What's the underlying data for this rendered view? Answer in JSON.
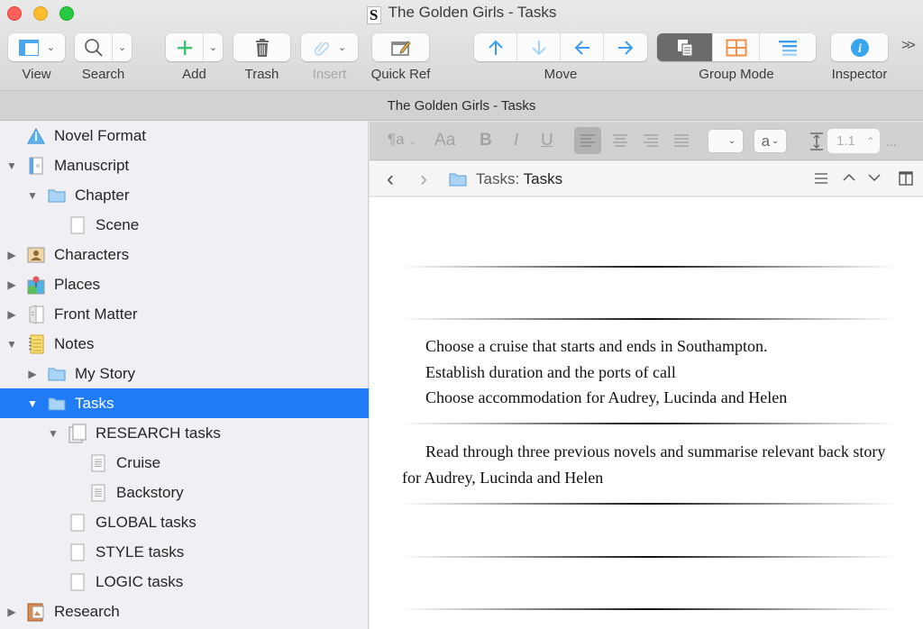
{
  "window": {
    "title": "The Golden Girls - Tasks",
    "app_icon": "scrivener-document-icon"
  },
  "toolbar": {
    "view_label": "View",
    "search_label": "Search",
    "add_label": "Add",
    "trash_label": "Trash",
    "insert_label": "Insert",
    "quickref_label": "Quick Ref",
    "move_label": "Move",
    "groupmode_label": "Group Mode",
    "inspector_label": "Inspector",
    "overflow": "»",
    "accent_blue": "#3b9cf0",
    "add_green": "#3cc373",
    "corkboard_orange": "#f0904a",
    "group_mode_selected": "scrivenings"
  },
  "header": {
    "title": "The Golden Girls - Tasks"
  },
  "binder": {
    "selection_color": "#1f7cf6",
    "items": [
      {
        "label": "Novel Format",
        "icon": "warning-info-icon",
        "depth": 0,
        "disclosure": ""
      },
      {
        "label": "Manuscript",
        "icon": "manuscript-icon",
        "depth": 0,
        "disclosure": "▼"
      },
      {
        "label": "Chapter",
        "icon": "folder-icon",
        "depth": 1,
        "disclosure": "▼"
      },
      {
        "label": "Scene",
        "icon": "blank-document-icon",
        "depth": 2,
        "disclosure": ""
      },
      {
        "label": "Characters",
        "icon": "character-icon",
        "depth": 0,
        "disclosure": "▶"
      },
      {
        "label": "Places",
        "icon": "places-icon",
        "depth": 0,
        "disclosure": "▶"
      },
      {
        "label": "Front Matter",
        "icon": "front-matter-icon",
        "depth": 0,
        "disclosure": "▶"
      },
      {
        "label": "Notes",
        "icon": "notepad-icon",
        "depth": 0,
        "disclosure": "▼"
      },
      {
        "label": "My Story",
        "icon": "folder-icon",
        "depth": 1,
        "disclosure": "▶"
      },
      {
        "label": "Tasks",
        "icon": "folder-icon",
        "depth": 1,
        "disclosure": "▼",
        "selected": true
      },
      {
        "label": "RESEARCH tasks",
        "icon": "document-stack-icon",
        "depth": 2,
        "disclosure": "▼"
      },
      {
        "label": "Cruise",
        "icon": "text-document-icon",
        "depth": 3,
        "disclosure": ""
      },
      {
        "label": "Backstory",
        "icon": "text-document-icon",
        "depth": 3,
        "disclosure": ""
      },
      {
        "label": "GLOBAL tasks",
        "icon": "blank-document-icon",
        "depth": 2,
        "disclosure": ""
      },
      {
        "label": "STYLE tasks",
        "icon": "blank-document-icon",
        "depth": 2,
        "disclosure": ""
      },
      {
        "label": "LOGIC tasks",
        "icon": "blank-document-icon",
        "depth": 2,
        "disclosure": ""
      },
      {
        "label": "Research",
        "icon": "research-icon",
        "depth": 0,
        "disclosure": "▶"
      }
    ]
  },
  "format_bar": {
    "paragraph_style": "¶a",
    "font": "Aa",
    "bold": "B",
    "italic": "I",
    "underline": "U",
    "text_color": "a",
    "line_spacing": "1.1",
    "more": "..."
  },
  "nav": {
    "back": "‹",
    "forward": "›",
    "path_prefix": "Tasks:",
    "path_title": "Tasks"
  },
  "editor": {
    "paragraphs": [
      {
        "lines": [
          "Choose a cruise that starts and ends in Southampton.",
          "Establish duration and the ports of call",
          "Choose accommodation for Audrey, Lucinda and Helen"
        ]
      },
      {
        "text": "Read through three previous novels and summarise relevant back story for Audrey, Lucinda and Helen"
      }
    ]
  }
}
